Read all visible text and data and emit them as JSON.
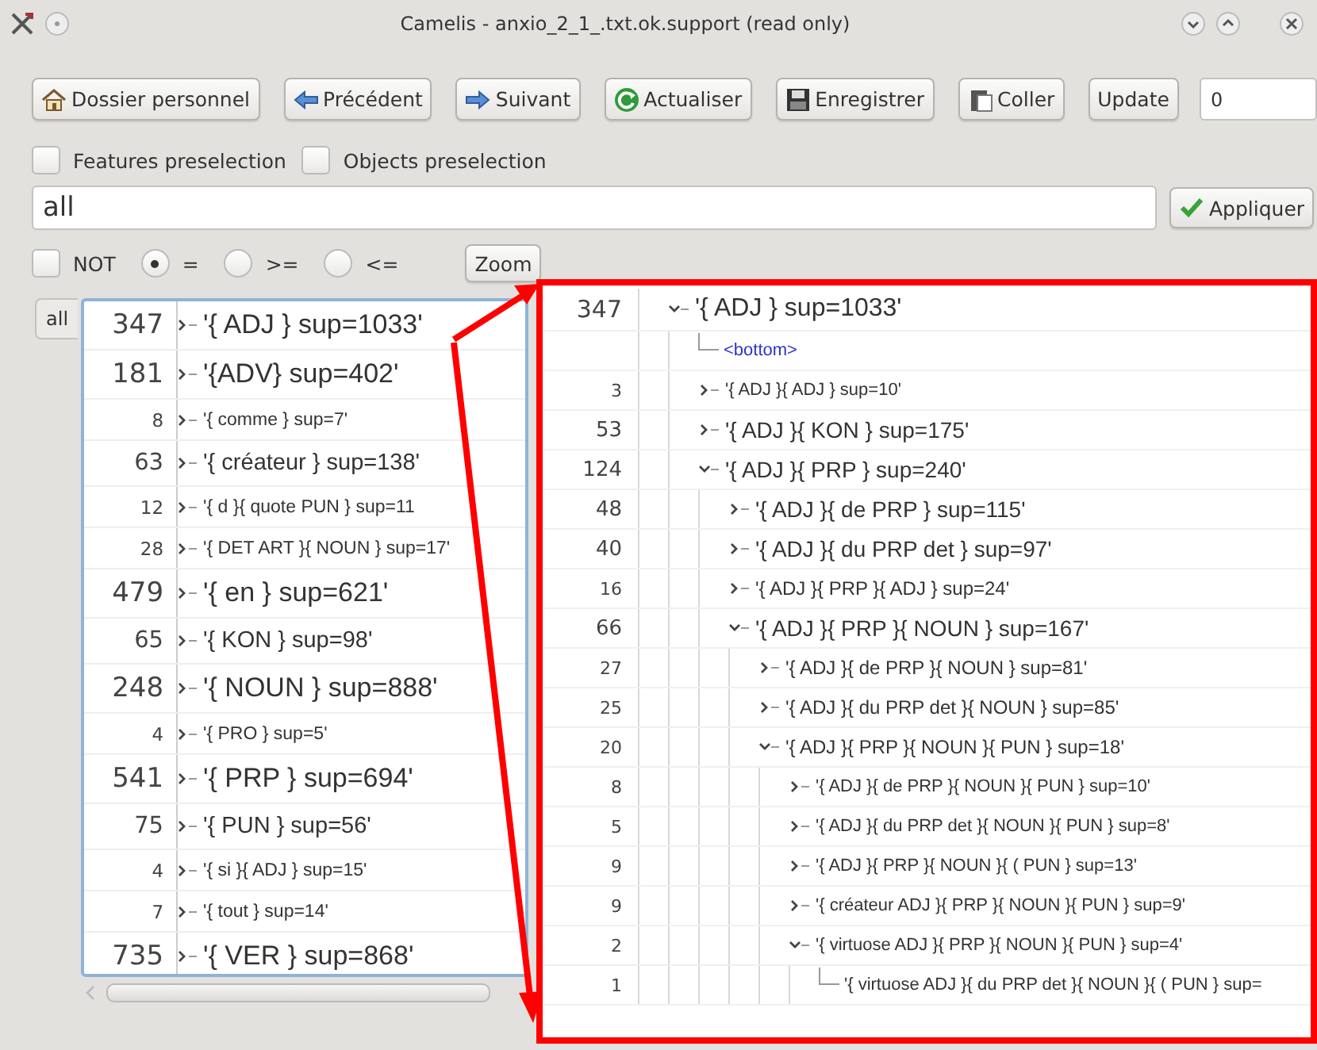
{
  "window": {
    "title": "Camelis - anxio_2_1_.txt.ok.support (read only)"
  },
  "toolbar": [
    {
      "label": "Dossier personnel"
    },
    {
      "label": "Précédent"
    },
    {
      "label": "Suivant"
    },
    {
      "label": "Actualiser"
    },
    {
      "label": "Enregistrer"
    },
    {
      "label": "Coller"
    },
    {
      "label": "Update"
    }
  ],
  "counter_field": {
    "value": "0"
  },
  "preselection": [
    {
      "label": "Features preselection",
      "checked": false
    },
    {
      "label": "Objects preselection",
      "checked": false
    }
  ],
  "query": {
    "value": "all"
  },
  "apply_button": "Appliquer",
  "not_option": {
    "label": "NOT",
    "checked": false
  },
  "comparisons": [
    {
      "label": "=",
      "selected": true
    },
    {
      "label": ">=",
      "selected": false
    },
    {
      "label": "<=",
      "selected": false
    }
  ],
  "zoom_button": "Zoom",
  "left_panel": {
    "tab": "all",
    "rows": [
      {
        "count": "347",
        "label": "'{ ADJ } sup=1033'",
        "kind": "large",
        "expanded": false
      },
      {
        "count": "181",
        "label": "'{ADV} sup=402'",
        "kind": "large",
        "expanded": false
      },
      {
        "count": "8",
        "label": "'{ comme } sup=7'",
        "kind": "small",
        "expanded": false
      },
      {
        "count": "63",
        "label": "'{ créateur } sup=138'",
        "kind": "medium",
        "expanded": false
      },
      {
        "count": "12",
        "label": "'{ d }{ quote PUN } sup=11",
        "kind": "small",
        "expanded": false
      },
      {
        "count": "28",
        "label": "'{ DET ART }{ NOUN } sup=17'",
        "kind": "small",
        "expanded": false
      },
      {
        "count": "479",
        "label": "'{ en } sup=621'",
        "kind": "large",
        "expanded": false
      },
      {
        "count": "65",
        "label": "'{ KON } sup=98'",
        "kind": "medium",
        "expanded": false
      },
      {
        "count": "248",
        "label": "'{ NOUN } sup=888'",
        "kind": "large",
        "expanded": false
      },
      {
        "count": "4",
        "label": "'{ PRO } sup=5'",
        "kind": "small",
        "expanded": false
      },
      {
        "count": "541",
        "label": "'{ PRP } sup=694'",
        "kind": "large",
        "expanded": false
      },
      {
        "count": "75",
        "label": "'{ PUN } sup=56'",
        "kind": "medium",
        "expanded": false
      },
      {
        "count": "4",
        "label": "'{ si }{ ADJ } sup=15'",
        "kind": "small",
        "expanded": false
      },
      {
        "count": "7",
        "label": "'{ tout } sup=14'",
        "kind": "small",
        "expanded": false
      },
      {
        "count": "735",
        "label": "'{ VER } sup=868'",
        "kind": "large",
        "expanded": false
      }
    ]
  },
  "zoom_inset": {
    "rows": [
      {
        "count": "347",
        "label": "'{ ADJ } sup=1033'",
        "kind": "large",
        "expanded": true,
        "children": [
          {
            "label": "<bottom>",
            "kind": "bottom"
          },
          {
            "count": "3",
            "label": "'{ ADJ }{ ADJ } sup=10'",
            "kind": "tiny",
            "expanded": false
          },
          {
            "count": "53",
            "label": "'{ ADJ }{ KON } sup=175'",
            "kind": "medium",
            "expanded": false
          },
          {
            "count": "124",
            "label": "'{ ADJ }{ PRP } sup=240'",
            "kind": "medium",
            "expanded": true,
            "children": [
              {
                "count": "48",
                "label": "'{ ADJ }{ de PRP } sup=115'",
                "kind": "medium",
                "expanded": false
              },
              {
                "count": "40",
                "label": "'{ ADJ }{ du PRP det } sup=97'",
                "kind": "medium",
                "expanded": false
              },
              {
                "count": "16",
                "label": "'{ ADJ }{ PRP }{ ADJ } sup=24'",
                "kind": "small",
                "expanded": false
              },
              {
                "count": "66",
                "label": "'{ ADJ }{ PRP }{ NOUN } sup=167'",
                "kind": "medium",
                "expanded": true,
                "children": [
                  {
                    "count": "27",
                    "label": "'{ ADJ }{ de PRP }{ NOUN } sup=81'",
                    "kind": "small",
                    "expanded": false
                  },
                  {
                    "count": "25",
                    "label": "'{ ADJ }{ du PRP det }{ NOUN } sup=85'",
                    "kind": "small",
                    "expanded": false
                  },
                  {
                    "count": "20",
                    "label": "'{ ADJ }{ PRP }{ NOUN }{ PUN } sup=18'",
                    "kind": "small",
                    "expanded": true,
                    "children": [
                      {
                        "count": "8",
                        "label": "'{ ADJ }{ de PRP }{ NOUN }{ PUN } sup=10'",
                        "kind": "tiny",
                        "expanded": false
                      },
                      {
                        "count": "5",
                        "label": "'{ ADJ }{ du PRP det }{ NOUN }{ PUN } sup=8'",
                        "kind": "tiny",
                        "expanded": false
                      },
                      {
                        "count": "9",
                        "label": "'{ ADJ }{ PRP }{ NOUN }{ ( PUN } sup=13'",
                        "kind": "tiny",
                        "expanded": false
                      },
                      {
                        "count": "9",
                        "label": "'{ créateur ADJ }{ PRP }{ NOUN }{ PUN } sup=9'",
                        "kind": "tiny",
                        "expanded": false
                      },
                      {
                        "count": "2",
                        "label": "'{ virtuose ADJ }{ PRP }{ NOUN }{ PUN } sup=4'",
                        "kind": "tiny",
                        "expanded": true,
                        "children": [
                          {
                            "count": "1",
                            "label": "'{ virtuose ADJ }{ du PRP det }{ NOUN }{ ( PUN } sup=",
                            "kind": "tiny"
                          }
                        ]
                      }
                    ]
                  }
                ]
              }
            ]
          }
        ]
      }
    ]
  }
}
